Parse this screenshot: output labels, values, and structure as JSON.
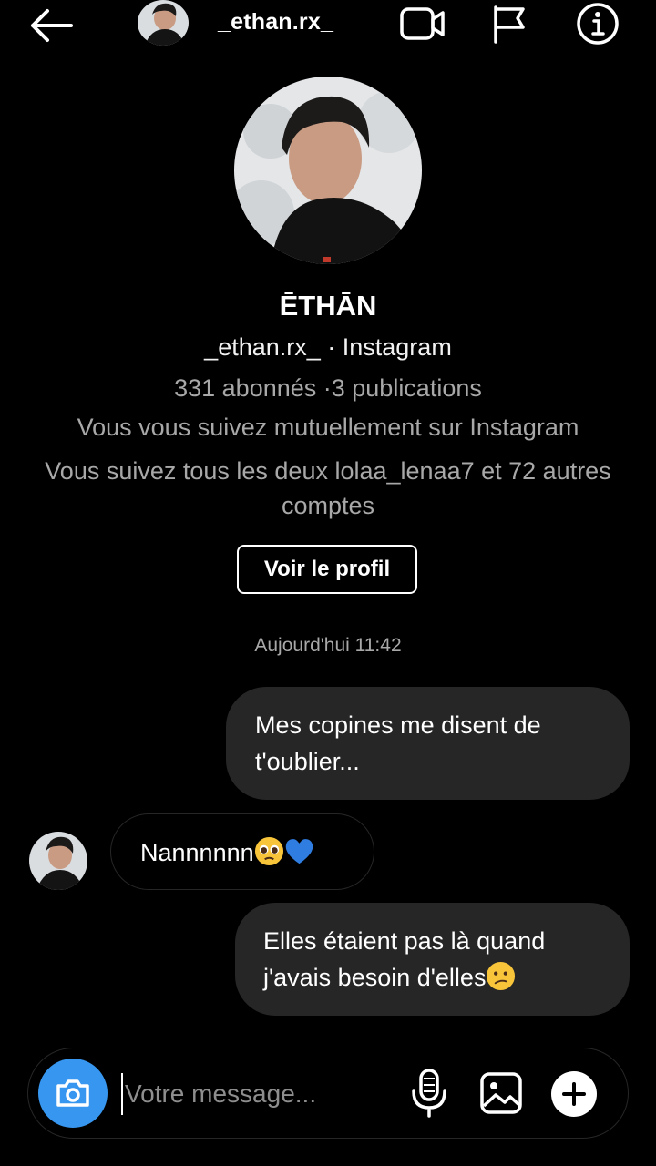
{
  "header": {
    "username": "_ethan.rx_",
    "back_icon": "arrow-left-icon",
    "video_icon": "video-call-icon",
    "flag_icon": "flag-icon",
    "info_icon": "info-icon"
  },
  "profile": {
    "display_name": "ĒTHĀN",
    "username_line": "_ethan.rx_ · Instagram",
    "stats": "331 abonnés ·3 publications",
    "mutual": "Vous vous suivez mutuellement sur Instagram",
    "common_followers": "Vous suivez tous les deux lolaa_lenaa7 et 72 autres comptes",
    "view_profile_label": "Voir le profil"
  },
  "thread": {
    "timestamp": "Aujourd'hui 11:42",
    "messages": [
      {
        "sender": "me",
        "text": "Mes copines me disent de t'oublier..."
      },
      {
        "sender": "them",
        "text": "Nannnnnn",
        "emojis": [
          "pleading-face",
          "blue-heart"
        ]
      },
      {
        "sender": "me",
        "text": "Elles étaient pas là quand j'avais besoin d'elles",
        "emojis": [
          "confused-face"
        ]
      }
    ]
  },
  "composer": {
    "placeholder": "Votre message...",
    "camera_icon": "camera-icon",
    "mic_icon": "microphone-icon",
    "gallery_icon": "gallery-icon",
    "plus_icon": "plus-icon"
  },
  "colors": {
    "background": "#000000",
    "bubble": "#262626",
    "secondary_text": "#a8a8a8",
    "camera_accent": "#3797f0"
  }
}
